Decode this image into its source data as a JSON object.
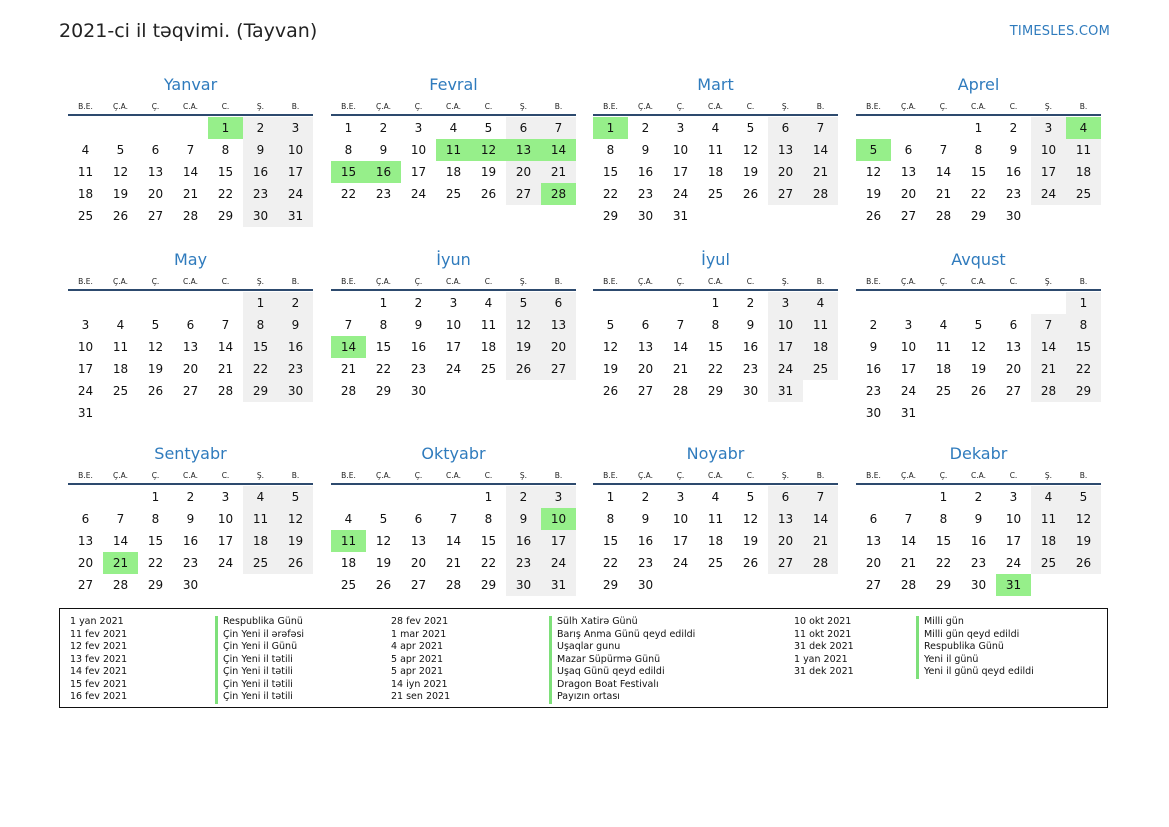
{
  "header": {
    "title": "2021-ci il təqvimi. (Tayvan)",
    "brand": "TIMESLES.COM"
  },
  "weekdays": [
    "B.E.",
    "Ç.A.",
    "Ç.",
    "C.A.",
    "C.",
    "Ş.",
    "B."
  ],
  "colors": {
    "accent": "#2f7bbd",
    "holiday": "#96ef8a",
    "weekend": "#f0f0f0"
  },
  "months": [
    {
      "name": "Yanvar",
      "offset": 4,
      "days": 31,
      "holidays": [
        1
      ]
    },
    {
      "name": "Fevral",
      "offset": 0,
      "days": 28,
      "holidays": [
        11,
        12,
        13,
        14,
        15,
        16,
        28
      ]
    },
    {
      "name": "Mart",
      "offset": 0,
      "days": 31,
      "holidays": [
        1
      ]
    },
    {
      "name": "Aprel",
      "offset": 3,
      "days": 30,
      "holidays": [
        4,
        5
      ]
    },
    {
      "name": "May",
      "offset": 5,
      "days": 31,
      "holidays": []
    },
    {
      "name": "İyun",
      "offset": 1,
      "days": 30,
      "holidays": [
        14
      ]
    },
    {
      "name": "İyul",
      "offset": 3,
      "days": 31,
      "holidays": []
    },
    {
      "name": "Avqust",
      "offset": 6,
      "days": 31,
      "holidays": []
    },
    {
      "name": "Sentyabr",
      "offset": 2,
      "days": 30,
      "holidays": [
        21
      ]
    },
    {
      "name": "Oktyabr",
      "offset": 4,
      "days": 31,
      "holidays": [
        10,
        11
      ]
    },
    {
      "name": "Noyabr",
      "offset": 0,
      "days": 30,
      "holidays": []
    },
    {
      "name": "Dekabr",
      "offset": 2,
      "days": 31,
      "holidays": [
        31
      ]
    }
  ],
  "legend": [
    [
      {
        "date": "1 yan 2021",
        "name": "Respublika Günü"
      },
      {
        "date": "11 fev 2021",
        "name": "Çin Yeni il ərəfəsi"
      },
      {
        "date": "12 fev 2021",
        "name": "Çin Yeni il Günü"
      },
      {
        "date": "13 fev 2021",
        "name": "Çin Yeni il tətili"
      },
      {
        "date": "14 fev 2021",
        "name": "Çin Yeni il tətili"
      },
      {
        "date": "15 fev 2021",
        "name": "Çin Yeni il tətili"
      },
      {
        "date": "16 fev 2021",
        "name": "Çin Yeni il tətili"
      }
    ],
    [
      {
        "date": "28 fev 2021",
        "name": "Sülh Xatirə Günü"
      },
      {
        "date": "1 mar 2021",
        "name": "Barış Anma Günü qeyd edildi"
      },
      {
        "date": "4 apr 2021",
        "name": "Uşaqlar gunu"
      },
      {
        "date": "5 apr 2021",
        "name": "Mazar Süpürmə Günü"
      },
      {
        "date": "5 apr 2021",
        "name": "Uşaq Günü qeyd edildi"
      },
      {
        "date": "14 iyn 2021",
        "name": "Dragon Boat Festivalı"
      },
      {
        "date": "21 sen 2021",
        "name": "Payızın ortası"
      }
    ],
    [
      {
        "date": "10 okt 2021",
        "name": "Milli gün"
      },
      {
        "date": "11 okt 2021",
        "name": "Milli gün qeyd edildi"
      },
      {
        "date": "31 dek 2021",
        "name": "Respublika Günü"
      },
      {
        "date": "1 yan 2021",
        "name": "Yeni il günü"
      },
      {
        "date": "31 dek 2021",
        "name": "Yeni il günü qeyd edildi"
      }
    ]
  ]
}
